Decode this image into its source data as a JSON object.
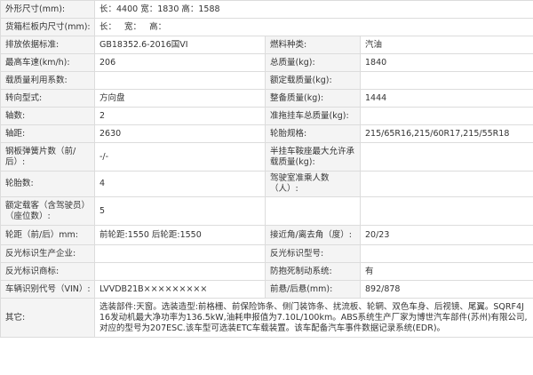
{
  "rows": [
    {
      "h": 20,
      "label": "外形尺寸(mm):",
      "full": "长：4400 宽：1830 高：1588"
    },
    {
      "h": 20,
      "label": "货箱栏板内尺寸(mm):",
      "full": "长：   宽：   高："
    },
    {
      "h": 20,
      "l1": "排放依据标准:",
      "v1": "GB18352.6-2016国VI",
      "l2": "燃料种类:",
      "v2": "汽油"
    },
    {
      "h": 20,
      "l1": "最高车速(km/h):",
      "v1": "206",
      "l2": "总质量(kg):",
      "v2": "1840"
    },
    {
      "h": 20,
      "l1": "载质量利用系数:",
      "v1": "",
      "l2": "额定载质量(kg):",
      "v2": ""
    },
    {
      "h": 20,
      "l1": "转向型式:",
      "v1": "方向盘",
      "l2": "整备质量(kg):",
      "v2": "1444"
    },
    {
      "h": 20,
      "l1": "轴数:",
      "v1": "2",
      "l2": "准拖挂车总质量(kg):",
      "v2": ""
    },
    {
      "h": 20,
      "l1": "轴距:",
      "v1": "2630",
      "l2": "轮胎规格:",
      "v2": "215/65R16,215/60R17,215/55R18"
    },
    {
      "h": 32,
      "l1": "钢板弹簧片数（前/后）:",
      "v1": "-/-",
      "l2": "半挂车鞍座最大允许承载质量(kg):",
      "v2": ""
    },
    {
      "h": 22,
      "l1": "轮胎数:",
      "v1": "4",
      "l2": "驾驶室准乘人数（人）:",
      "v2": ""
    },
    {
      "h": 32,
      "l1": "额定载客（含驾驶员）（座位数）:",
      "v1": "5",
      "l2": "",
      "v2": ""
    },
    {
      "h": 22,
      "l1": "轮距（前/后）mm:",
      "v1": "前轮距:1550 后轮距:1550",
      "l2": "接近角/离去角（度）:",
      "v2": "20/23"
    },
    {
      "h": 20,
      "l1": "反光标识生产企业:",
      "v1": "",
      "l2": "反光标识型号:",
      "v2": ""
    },
    {
      "h": 20,
      "l1": "反光标识商标:",
      "v1": "",
      "l2": "防抱死制动系统:",
      "v2": "有"
    },
    {
      "h": 20,
      "l1": "车辆识别代号（VIN）:",
      "v1": "LVVDB21B×××××××××",
      "l2": "前悬/后悬(mm):",
      "v2": "892/878"
    },
    {
      "h": 44,
      "label": "其它:",
      "full": "选装部件:天窗。选装造型:前格栅、前保险饰条、侧门装饰条、扰流板、轮辋、双色车身、后视镜、尾翼。SQRF4J16发动机最大净功率为136.5kW,油耗申报值为7.10L/100km。ABS系统生产厂家为博世汽车部件(苏州)有限公司,对应的型号为207ESC.该车型可选装ETC车载装置。该车配备汽车事件数据记录系统(EDR)。"
    }
  ]
}
